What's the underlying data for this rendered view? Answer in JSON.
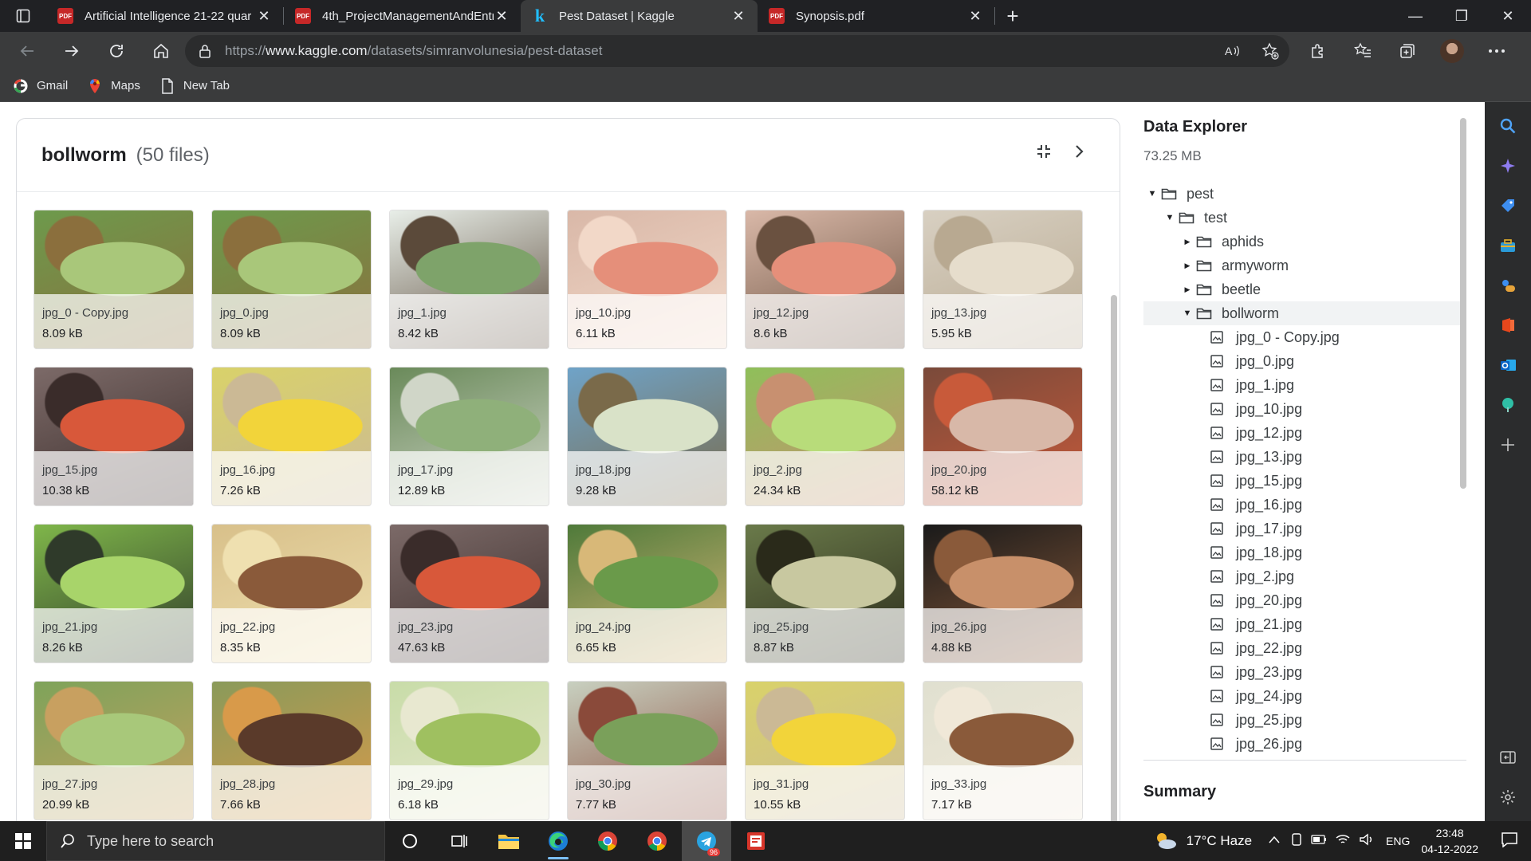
{
  "browser": {
    "tabs": [
      {
        "title": "Artificial Intelligence 21-22 quar",
        "icon": "pdf-icon",
        "active": false
      },
      {
        "title": "4th_ProjectManagementAndEntr",
        "icon": "pdf-icon",
        "active": false
      },
      {
        "title": "Pest Dataset | Kaggle",
        "icon": "kaggle-icon",
        "active": true
      },
      {
        "title": "Synopsis.pdf",
        "icon": "pdf-icon",
        "active": false
      }
    ],
    "url_prefix": "https://",
    "url_domain": "www.kaggle.com",
    "url_path": "/datasets/simranvolunesia/pest-dataset",
    "bookmarks": [
      {
        "label": "Gmail",
        "icon": "google-icon"
      },
      {
        "label": "Maps",
        "icon": "maps-pin-icon"
      },
      {
        "label": "New Tab",
        "icon": "page-icon"
      }
    ]
  },
  "panel": {
    "title": "bollworm",
    "count": "(50 files)",
    "files": [
      {
        "name": "jpg_0 - Copy.jpg",
        "size": "8.09 kB"
      },
      {
        "name": "jpg_0.jpg",
        "size": "8.09 kB"
      },
      {
        "name": "jpg_1.jpg",
        "size": "8.42 kB"
      },
      {
        "name": "jpg_10.jpg",
        "size": "6.11 kB"
      },
      {
        "name": "jpg_12.jpg",
        "size": "8.6 kB"
      },
      {
        "name": "jpg_13.jpg",
        "size": "5.95 kB"
      },
      {
        "name": "jpg_15.jpg",
        "size": "10.38 kB"
      },
      {
        "name": "jpg_16.jpg",
        "size": "7.26 kB"
      },
      {
        "name": "jpg_17.jpg",
        "size": "12.89 kB"
      },
      {
        "name": "jpg_18.jpg",
        "size": "9.28 kB"
      },
      {
        "name": "jpg_2.jpg",
        "size": "24.34 kB"
      },
      {
        "name": "jpg_20.jpg",
        "size": "58.12 kB"
      },
      {
        "name": "jpg_21.jpg",
        "size": "8.26 kB"
      },
      {
        "name": "jpg_22.jpg",
        "size": "8.35 kB"
      },
      {
        "name": "jpg_23.jpg",
        "size": "47.63 kB"
      },
      {
        "name": "jpg_24.jpg",
        "size": "6.65 kB"
      },
      {
        "name": "jpg_25.jpg",
        "size": "8.87 kB"
      },
      {
        "name": "jpg_26.jpg",
        "size": "4.88 kB"
      },
      {
        "name": "jpg_27.jpg",
        "size": "20.99 kB"
      },
      {
        "name": "jpg_28.jpg",
        "size": "7.66 kB"
      },
      {
        "name": "jpg_29.jpg",
        "size": "6.18 kB"
      },
      {
        "name": "jpg_30.jpg",
        "size": "7.77 kB"
      },
      {
        "name": "jpg_31.jpg",
        "size": "10.55 kB"
      },
      {
        "name": "jpg_33.jpg",
        "size": "7.17 kB"
      }
    ]
  },
  "explorer": {
    "title": "Data Explorer",
    "size": "73.25 MB",
    "tree": [
      {
        "label": "pest",
        "type": "folder",
        "depth": 0,
        "caret": "open"
      },
      {
        "label": "test",
        "type": "folder",
        "depth": 1,
        "caret": "open"
      },
      {
        "label": "aphids",
        "type": "folder",
        "depth": 2,
        "caret": "closed"
      },
      {
        "label": "armyworm",
        "type": "folder",
        "depth": 2,
        "caret": "closed"
      },
      {
        "label": "beetle",
        "type": "folder",
        "depth": 2,
        "caret": "closed"
      },
      {
        "label": "bollworm",
        "type": "folder",
        "depth": 2,
        "caret": "open",
        "selected": true
      },
      {
        "label": "jpg_0 - Copy.jpg",
        "type": "image",
        "depth": 3
      },
      {
        "label": "jpg_0.jpg",
        "type": "image",
        "depth": 3
      },
      {
        "label": "jpg_1.jpg",
        "type": "image",
        "depth": 3
      },
      {
        "label": "jpg_10.jpg",
        "type": "image",
        "depth": 3
      },
      {
        "label": "jpg_12.jpg",
        "type": "image",
        "depth": 3
      },
      {
        "label": "jpg_13.jpg",
        "type": "image",
        "depth": 3
      },
      {
        "label": "jpg_15.jpg",
        "type": "image",
        "depth": 3
      },
      {
        "label": "jpg_16.jpg",
        "type": "image",
        "depth": 3
      },
      {
        "label": "jpg_17.jpg",
        "type": "image",
        "depth": 3
      },
      {
        "label": "jpg_18.jpg",
        "type": "image",
        "depth": 3
      },
      {
        "label": "jpg_2.jpg",
        "type": "image",
        "depth": 3
      },
      {
        "label": "jpg_20.jpg",
        "type": "image",
        "depth": 3
      },
      {
        "label": "jpg_21.jpg",
        "type": "image",
        "depth": 3
      },
      {
        "label": "jpg_22.jpg",
        "type": "image",
        "depth": 3
      },
      {
        "label": "jpg_23.jpg",
        "type": "image",
        "depth": 3
      },
      {
        "label": "jpg_24.jpg",
        "type": "image",
        "depth": 3
      },
      {
        "label": "jpg_25.jpg",
        "type": "image",
        "depth": 3
      },
      {
        "label": "jpg_26.jpg",
        "type": "image",
        "depth": 3
      }
    ],
    "summary_title": "Summary"
  },
  "taskbar": {
    "search_placeholder": "Type here to search",
    "weather": "17°C  Haze",
    "language": "ENG",
    "time": "23:48",
    "date": "04-12-2022",
    "telegram_badge": "96"
  }
}
